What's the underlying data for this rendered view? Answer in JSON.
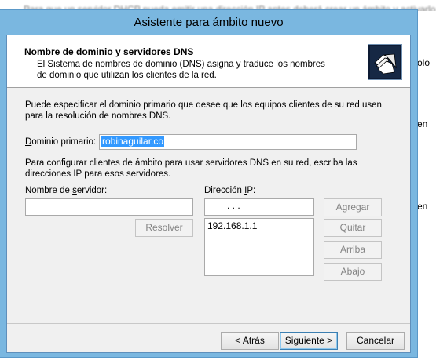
{
  "background": {
    "top_text": "Para que un servidor DHCP pueda emitir una dirección IP antes deberá crear un ámbito y activarlo en el",
    "side_texts": [
      "olo",
      "en",
      "en"
    ]
  },
  "window": {
    "title": "Asistente para ámbito nuevo"
  },
  "header": {
    "title": "Nombre de dominio y servidores DNS",
    "description": "El Sistema de nombres de dominio (DNS) asigna y traduce los nombres de dominio que utilizan los clientes de la red.",
    "icon": "folders-icon"
  },
  "body": {
    "intro": "Puede especificar el dominio primario que desee que los equipos clientes de su red usen para la resolución de nombres DNS.",
    "domain_label": "Dominio primario:",
    "domain_value": "robinaguilar.co",
    "dns_intro": "Para configurar clientes de ámbito para usar servidores DNS en su red, escriba las direcciones IP para esos servidores.",
    "server_label": "Nombre de servidor:",
    "server_value": "",
    "ip_label": "Dirección IP:",
    "ip_input_value": ".   .   .",
    "ip_list": [
      "192.168.1.1"
    ],
    "buttons": {
      "resolve": "Resolver",
      "add": "Agregar",
      "remove": "Quitar",
      "up": "Arriba",
      "down": "Abajo"
    }
  },
  "footer": {
    "back": "< Atrás",
    "next": "Siguiente >",
    "cancel": "Cancelar"
  }
}
